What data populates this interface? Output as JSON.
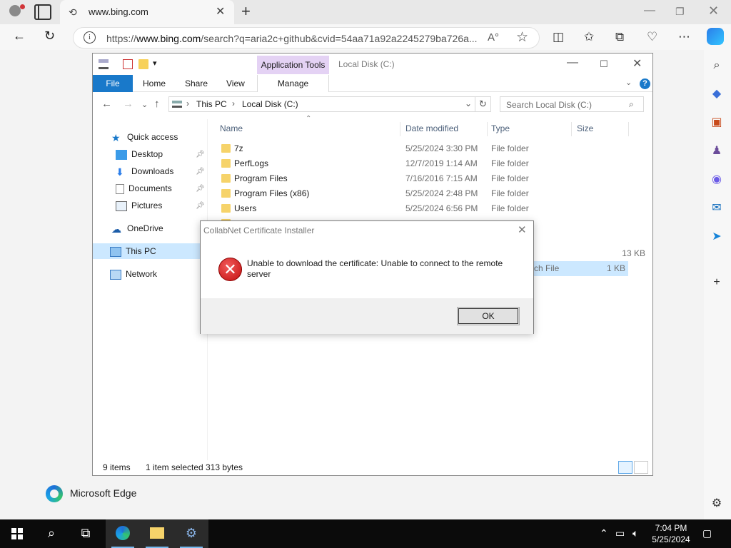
{
  "browser": {
    "tab_title": "www.bing.com",
    "url_prefix": "https://",
    "url_host": "www.bing.com",
    "url_rest": "/search?q=aria2c+github&cvid=54aa71a92a2245279ba726a...",
    "page_footer_label": "Microsoft Edge"
  },
  "explorer": {
    "app_tools_label": "Application Tools",
    "window_title": "Local Disk (C:)",
    "ribbon": {
      "file": "File",
      "home": "Home",
      "share": "Share",
      "view": "View",
      "manage": "Manage"
    },
    "breadcrumb": [
      "This PC",
      "Local Disk (C:)"
    ],
    "search_placeholder": "Search Local Disk (C:)",
    "nav_items": [
      {
        "label": "Quick access"
      },
      {
        "label": "Desktop"
      },
      {
        "label": "Downloads"
      },
      {
        "label": "Documents"
      },
      {
        "label": "Pictures"
      },
      {
        "label": "OneDrive"
      },
      {
        "label": "This PC"
      },
      {
        "label": "Network"
      }
    ],
    "columns": [
      "Name",
      "Date modified",
      "Type",
      "Size"
    ],
    "files": [
      {
        "name": "7z",
        "date": "5/25/2024 3:30 PM",
        "type": "File folder",
        "size": ""
      },
      {
        "name": "PerfLogs",
        "date": "12/7/2019 1:14 AM",
        "type": "File folder",
        "size": ""
      },
      {
        "name": "Program Files",
        "date": "7/16/2016 7:15 AM",
        "type": "File folder",
        "size": ""
      },
      {
        "name": "Program Files (x86)",
        "date": "5/25/2024 2:48 PM",
        "type": "File folder",
        "size": ""
      },
      {
        "name": "Users",
        "date": "5/25/2024 6:56 PM",
        "type": "File folder",
        "size": ""
      }
    ],
    "partial_row_1": {
      "type": "",
      "size": "13 KB"
    },
    "partial_row_2": {
      "type": "atch File",
      "size": "1 KB"
    },
    "status": {
      "items": "9 items",
      "selection": "1 item selected",
      "bytes": "313 bytes"
    }
  },
  "dialog": {
    "title": "CollabNet Certificate Installer",
    "message": "Unable to download the certificate: Unable to connect to the remote server",
    "ok_label": "OK"
  },
  "taskbar": {
    "time": "7:04 PM",
    "date": "5/25/2024"
  },
  "colors": {
    "accent": "#1979ca",
    "app_tools": "#e4d2f4",
    "selection": "#cce8ff",
    "error": "#c20f0f"
  }
}
